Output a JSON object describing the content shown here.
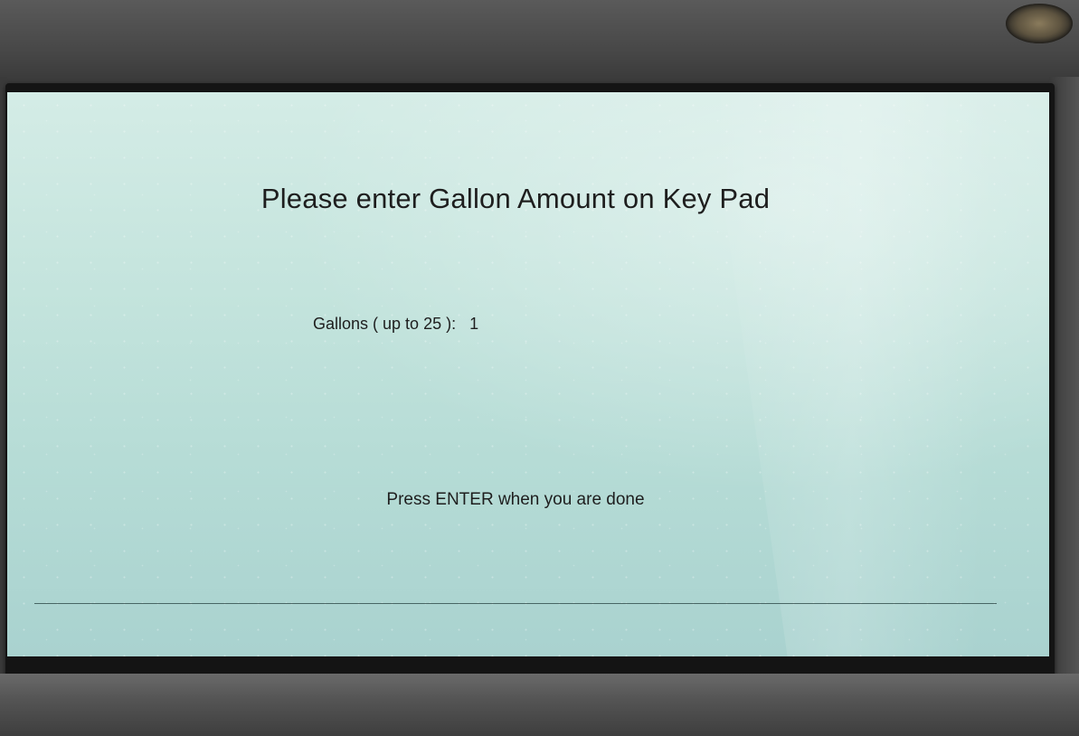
{
  "screen": {
    "title": "Please enter Gallon Amount on Key Pad",
    "gallons_label": "Gallons ( up to 25 ):",
    "gallons_value": "1",
    "instruction": "Press ENTER when you are done"
  },
  "colors": {
    "screen_background": "#c4e4dd",
    "text": "#1e1e1e",
    "bezel": "#141414",
    "housing": "#3a3a3a"
  }
}
